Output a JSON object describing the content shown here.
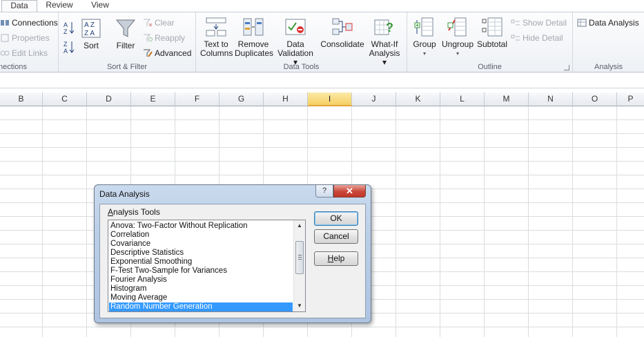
{
  "tabs": [
    "Data",
    "Review",
    "View"
  ],
  "ribbon": {
    "connections": {
      "connections": "Connections",
      "properties": "Properties",
      "edit_links": "Edit Links",
      "label": "nections"
    },
    "sort_filter": {
      "sort": "Sort",
      "filter": "Filter",
      "clear": "Clear",
      "reapply": "Reapply",
      "advanced": "Advanced",
      "label": "Sort & Filter"
    },
    "data_tools": {
      "text_to_columns": [
        "Text to",
        "Columns"
      ],
      "remove_duplicates": [
        "Remove",
        "Duplicates"
      ],
      "data_validation": [
        "Data",
        "Validation ▾"
      ],
      "consolidate": "Consolidate",
      "what_if": [
        "What-If",
        "Analysis ▾"
      ],
      "label": "Data Tools"
    },
    "outline": {
      "group": "Group",
      "ungroup": "Ungroup",
      "subtotal": "Subtotal",
      "show_detail": "Show Detail",
      "hide_detail": "Hide Detail",
      "label": "Outline"
    },
    "analysis": {
      "data_analysis": "Data Analysis",
      "label": "Analysis"
    }
  },
  "columns": [
    "B",
    "C",
    "D",
    "E",
    "F",
    "G",
    "H",
    "I",
    "J",
    "K",
    "L",
    "M",
    "N",
    "O",
    "P"
  ],
  "selected_column": "I",
  "dialog": {
    "title": "Data Analysis",
    "help_glyph": "?",
    "close_glyph": "✕",
    "tools_label_underlined": "A",
    "tools_label_rest": "nalysis Tools",
    "tools": [
      "Anova: Two-Factor Without Replication",
      "Correlation",
      "Covariance",
      "Descriptive Statistics",
      "Exponential Smoothing",
      "F-Test Two-Sample for Variances",
      "Fourier Analysis",
      "Histogram",
      "Moving Average",
      "Random Number Generation"
    ],
    "selected_tool": "Random Number Generation",
    "ok": "OK",
    "cancel": "Cancel",
    "help_underlined": "H",
    "help_rest": "elp"
  },
  "colors": {
    "selection": "#3399ff",
    "column_highlight": "#f5cf62",
    "close_button": "#c9473a"
  }
}
